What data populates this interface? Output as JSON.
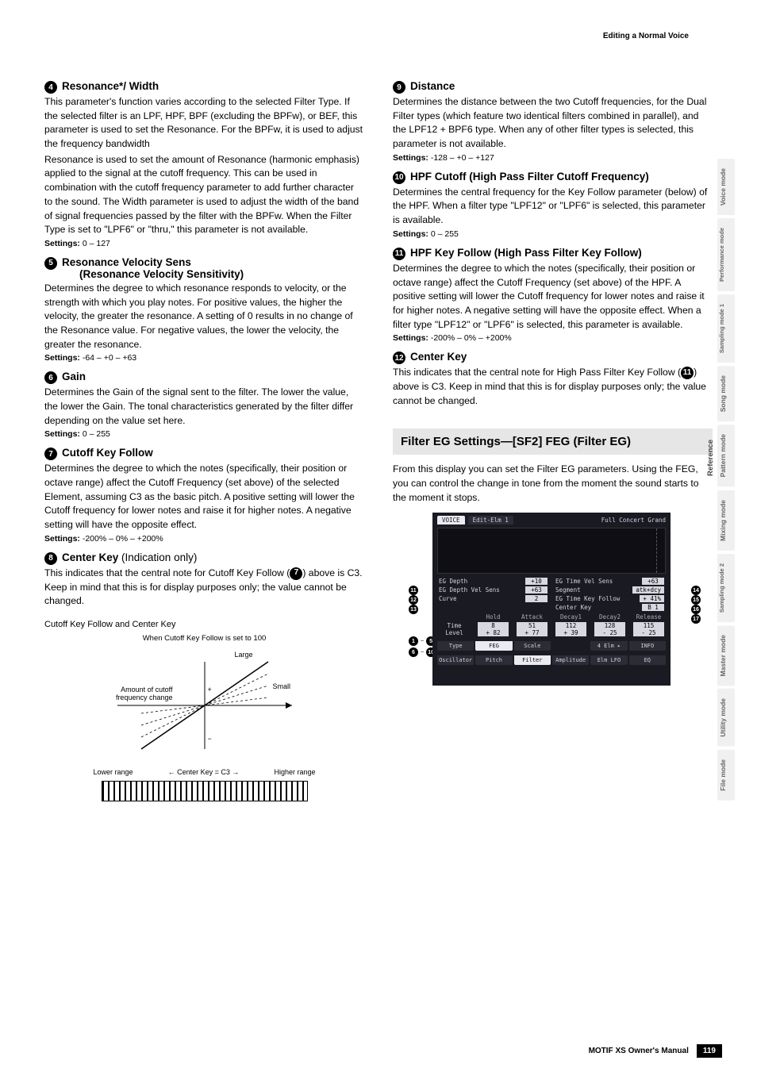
{
  "header": {
    "breadcrumb": "Editing a Normal Voice"
  },
  "side_tabs": {
    "items": [
      {
        "label": "Voice mode"
      },
      {
        "label": "Performance mode"
      },
      {
        "label": "Sampling mode 1"
      },
      {
        "label": "Song mode"
      },
      {
        "label": "Pattern mode"
      },
      {
        "label": "Mixing mode"
      },
      {
        "label": "Sampling mode 2"
      },
      {
        "label": "Master mode"
      },
      {
        "label": "Utility mode"
      },
      {
        "label": "File mode"
      }
    ],
    "reference": "Reference"
  },
  "left": {
    "s4": {
      "num": "4",
      "title": "Resonance*/ Width",
      "p1": "This parameter's function varies according to the selected Filter Type. If the selected filter is an LPF, HPF, BPF (excluding the BPFw), or BEF, this parameter is used to set the Resonance. For the BPFw, it is used to adjust the frequency bandwidth",
      "p2": "Resonance is used to set the amount of Resonance (harmonic emphasis) applied to the signal at the cutoff frequency. This can be used in combination with the cutoff frequency parameter to add further character to the sound. The Width parameter is used to adjust the width of the band of signal frequencies passed by the filter with the BPFw. When the Filter Type is set to \"LPF6\" or \"thru,\" this parameter is not available.",
      "settings": "0 – 127"
    },
    "s5": {
      "num": "5",
      "title_line1": "Resonance Velocity Sens",
      "title_line2": "(Resonance Velocity Sensitivity)",
      "p1": "Determines the degree to which resonance responds to velocity, or the strength with which you play notes. For positive values, the higher the velocity, the greater the resonance. A setting of 0 results in no change of the Resonance value. For negative values, the lower the velocity, the greater the resonance.",
      "settings": "-64 – +0 – +63"
    },
    "s6": {
      "num": "6",
      "title": "Gain",
      "p1": "Determines the Gain of the signal sent to the filter. The lower the value, the lower the Gain. The tonal characteristics generated by the filter differ depending on the value set here.",
      "settings": "0 – 255"
    },
    "s7": {
      "num": "7",
      "title": "Cutoff Key Follow",
      "p1": "Determines the degree to which the notes (specifically, their position or octave range) affect the Cutoff Frequency (set above) of the selected Element, assuming C3 as the basic pitch. A positive setting will lower the Cutoff frequency for lower notes and raise it for higher notes. A negative setting will have the opposite effect.",
      "settings": "-200% – 0% – +200%"
    },
    "s8": {
      "num": "8",
      "title": "Center Key",
      "tail": " (Indication only)",
      "p1_a": "This indicates that the central note for Cutoff Key Follow (",
      "p1_ref": "7",
      "p1_b": ") above is C3. Keep in mind that this is for display purposes only; the value cannot be changed."
    },
    "diagram": {
      "caption": "Cutoff Key Follow and Center Key",
      "top": "When Cutoff Key Follow is set to 100",
      "large": "Large",
      "small": "Small",
      "amount1": "Amount of cutoff",
      "amount2": "frequency change",
      "plus": "+",
      "minus": "−",
      "axis_left": "Lower range",
      "axis_mid": "Center Key = C3",
      "axis_right": "Higher range"
    }
  },
  "right": {
    "s9": {
      "num": "9",
      "title": "Distance",
      "p1": "Determines the distance between the two Cutoff frequencies, for the Dual Filter types (which feature two identical filters combined in parallel), and the LPF12 + BPF6 type. When any of other filter types is selected, this parameter is not available.",
      "settings": "-128 – +0 – +127"
    },
    "s10": {
      "num": "10",
      "title": "HPF Cutoff (High Pass Filter Cutoff Frequency)",
      "p1": "Determines the central frequency for the Key Follow parameter (below) of the HPF. When a filter type \"LPF12\" or \"LPF6\" is selected, this parameter is available.",
      "settings": "0 – 255"
    },
    "s11": {
      "num": "11",
      "title": "HPF Key Follow (High Pass Filter Key Follow)",
      "p1": "Determines the degree to which the notes (specifically, their position or octave range) affect the Cutoff Frequency (set above) of the HPF. A positive setting will lower the Cutoff frequency for lower notes and raise it for higher notes. A negative setting will have the opposite effect. When a filter type \"LPF12\" or \"LPF6\" is selected, this parameter is available.",
      "settings": "-200% – 0% – +200%"
    },
    "s12": {
      "num": "12",
      "title": "Center Key",
      "p1_a": "This indicates that the central note for High Pass Filter Key Follow (",
      "p1_ref": "11",
      "p1_b": ") above is C3. Keep in mind that this is for display purposes only; the value cannot be changed."
    },
    "filter_eg": {
      "title": "Filter EG Settings—[SF2] FEG (Filter EG)",
      "intro": "From this display you can set the Filter EG parameters. Using the FEG, you can control the change in tone from the moment the sound starts to the moment it stops."
    },
    "screenshot": {
      "title_tabs": {
        "voice": "VOICE",
        "edit": "Edit-Elm 1",
        "preset": "Full Concert Grand"
      },
      "left_params": [
        {
          "label": "EG Depth",
          "value": "+10"
        },
        {
          "label": "EG Depth Vel Sens",
          "value": "+63"
        },
        {
          "label": "Curve",
          "value": "2"
        }
      ],
      "right_params": [
        {
          "label": "EG Time Vel Sens",
          "value": "+63"
        },
        {
          "label": "Segment",
          "value": "atk+dcy"
        },
        {
          "label": "EG Time Key Follow",
          "value": "+ 41%"
        },
        {
          "label": "Center Key",
          "value": "B 1"
        }
      ],
      "env_header": [
        "",
        "Hold",
        "Attack",
        "Decay1",
        "Decay2",
        "Release"
      ],
      "env_time": [
        "Time",
        "8",
        "51",
        "112",
        "128",
        "115"
      ],
      "env_level": [
        "Level",
        "+ 82",
        "+ 77",
        "+ 39",
        "- 25",
        "- 25"
      ],
      "row_sf": [
        "Type",
        "FEG",
        "Scale",
        "",
        "4 Elm ▸",
        "INFO"
      ],
      "row_bottom": [
        "Oscillator",
        "Pitch",
        "Filter",
        "Amplitude",
        "Elm LFO",
        "EQ"
      ],
      "callouts_left_mid": [
        "11",
        "12",
        "13"
      ],
      "callouts_left_env": {
        "a": "1",
        "b": "5",
        "c": "6",
        "d": "10"
      },
      "callouts_right_mid": [
        "14",
        "15",
        "16",
        "17"
      ]
    }
  },
  "settings_label": "Settings:",
  "footer": {
    "manual": "MOTIF XS Owner's Manual",
    "page": "119"
  }
}
